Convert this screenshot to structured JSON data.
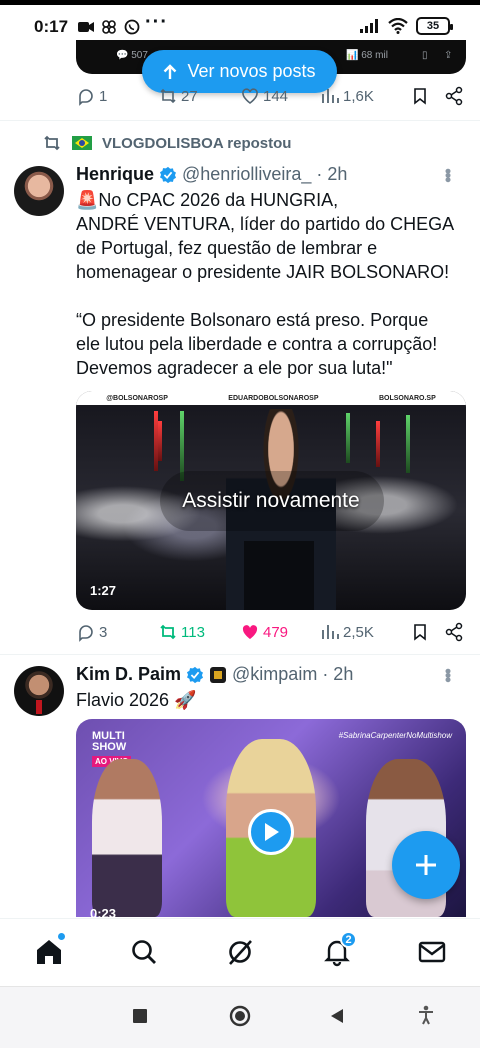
{
  "status_bar": {
    "time": "17",
    "battery": "35",
    "left_icons": [
      "video-camera-icon",
      "app-grid-icon",
      "whatsapp-icon"
    ],
    "right_icons": [
      "signal-icon",
      "wifi-icon",
      "battery-icon"
    ]
  },
  "prev_tweet": {
    "media_stats": {
      "replies": "507",
      "views": "68 mil"
    },
    "actions": {
      "replies": "1",
      "reposts": "27",
      "likes": "144",
      "views": "1,6K"
    }
  },
  "new_posts_button": {
    "label": "Ver novos posts"
  },
  "repost_banner": {
    "text": "VLOGDOLISBOA repostou"
  },
  "tweet1": {
    "name": "Henrique",
    "handle": "@henriolliveira_",
    "time": "· 2h",
    "text": "🚨No CPAC 2026 da HUNGRIA,\nANDRÉ VENTURA, líder do partido do CHEGA\nde Portugal, fez questão de lembrar e\nhomenagear o presidente JAIR BOLSONARO!\n\n“O presidente Bolsonaro está preso. Porque\nele lutou pela liberdade e contra a corrupção!\nDevemos agradecer a ele por sua luta!\"",
    "media": {
      "watermarks": [
        "@BOLSONAROSP",
        "EDUARDOBOLSONAROSP",
        "BOLSONARO.SP"
      ],
      "replay_label": "Assistir novamente",
      "duration": "1:27"
    },
    "actions": {
      "replies": "3",
      "reposts": "113",
      "likes": "479",
      "views": "2,5K"
    }
  },
  "tweet2": {
    "name": "Kim D. Paim",
    "handle": "@kimpaim",
    "time": "· 2h",
    "text": "Flavio 2026 🚀",
    "media": {
      "logo_line1": "MULTI",
      "logo_line2": "SHOW",
      "logo_badge": "AO VIVO",
      "hashtag": "#SabrinaCarpenterNoMultishow",
      "duration": "0:23"
    }
  },
  "fab": {
    "icon": "plus-icon"
  },
  "bottom_nav": {
    "items": [
      "home-icon",
      "search-icon",
      "grok-icon",
      "notifications-icon",
      "messages-icon"
    ],
    "notification_count": "2"
  },
  "system_nav": {
    "items": [
      "recents-icon",
      "home-circle-icon",
      "back-icon",
      "accessibility-icon"
    ]
  },
  "colors": {
    "accent": "#1d9bf0",
    "repost_active": "#00ba7c",
    "like_active": "#f91880",
    "text": "#0f1419",
    "muted": "#536471"
  }
}
